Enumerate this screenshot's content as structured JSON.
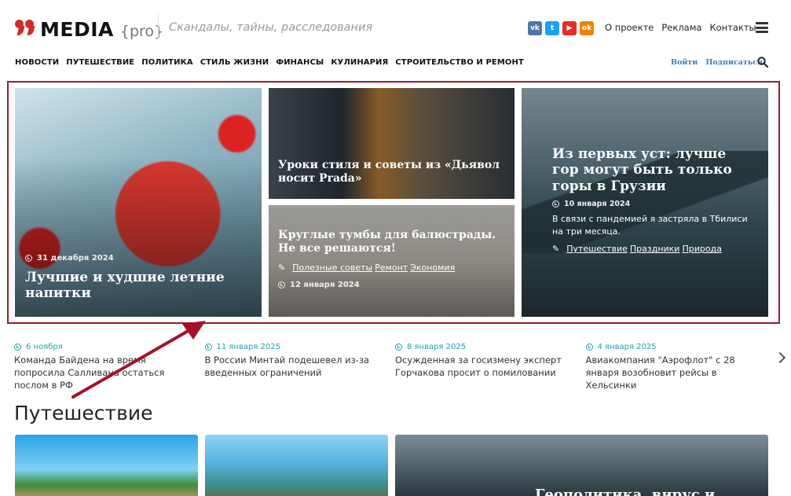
{
  "header": {
    "logo_name": "MEDIA",
    "logo_pro": "{pro}",
    "tagline": "Скандалы, тайны, расследования",
    "social": [
      "vk-icon",
      "twitter-icon",
      "youtube-icon",
      "odnoklassniki-icon"
    ],
    "links": [
      "О проекте",
      "Реклама",
      "Контакты"
    ]
  },
  "nav": {
    "items": [
      "НОВОСТИ",
      "ПУТЕШЕСТВИЕ",
      "ПОЛИТИКА",
      "СТИЛЬ ЖИЗНИ",
      "ФИНАНСЫ",
      "КУЛИНАРИЯ",
      "СТРОИТЕЛЬСТВО И РЕМОНТ"
    ],
    "login": "Войти",
    "subscribe": "Подписаться"
  },
  "hero": {
    "t1": {
      "date": "31 декабря 2024",
      "title": "Лучшие и худшие летние напитки"
    },
    "t2": {
      "title": "Уроки стиля и советы из «Дьявол носит Prada»"
    },
    "t3": {
      "title": "Круглые тумбы для балюстрады. Не все решаются!",
      "tags": [
        "Полезные советы",
        "Ремонт",
        "Экономия"
      ],
      "date": "12 января 2024"
    },
    "t4": {
      "title": "Из первых уст: лучше гор могут быть только горы в Грузии",
      "date": "10 января 2024",
      "excerpt": "В связи с пандемией я застряла в Тбилиси на три месяца.",
      "tags": [
        "Путешествие",
        "Праздники",
        "Природа"
      ]
    }
  },
  "ticker": [
    {
      "date": "6 ноября",
      "text": "Команда Байдена на время попросила Салливана остаться послом в РФ"
    },
    {
      "date": "11 января 2025",
      "text": "В России Минтай подешевел из-за введенных ограничений"
    },
    {
      "date": "8 января 2025",
      "text": "Осужденная за госизмену эксперт Горчакова просит о помиловании"
    },
    {
      "date": "4 января 2025",
      "text": "Авиакомпания \"Аэрофлот\" с 28 января возобновит рейсы в Хельсинки"
    }
  ],
  "section": {
    "title": "Путешествие",
    "card3_title": "Геополитика, вирус и"
  },
  "colors": {
    "accent": "#d12a2a",
    "frame": "#9a1b2c",
    "date": "#1ea1b5",
    "auth": "#3b7bb5"
  }
}
